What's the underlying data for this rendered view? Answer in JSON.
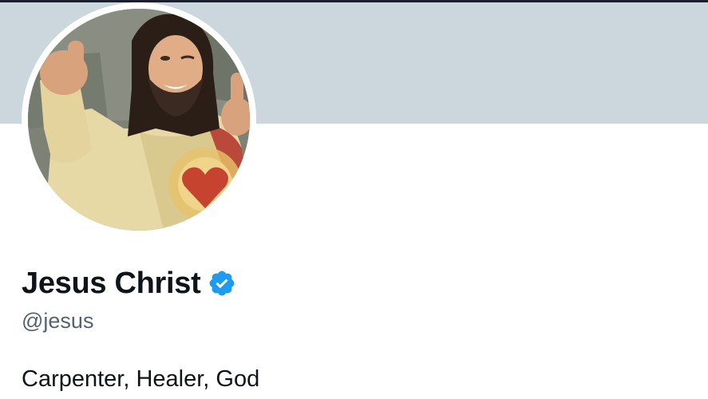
{
  "profile": {
    "display_name": "Jesus Christ",
    "handle": "@jesus",
    "bio": "Carpenter, Healer, God",
    "verified": true
  },
  "colors": {
    "banner": "#ccd6dd",
    "verified_badge": "#1d9bf0",
    "name_text": "#0f1419",
    "handle_text": "#536471"
  },
  "icons": {
    "verified": "verified-badge-icon"
  }
}
